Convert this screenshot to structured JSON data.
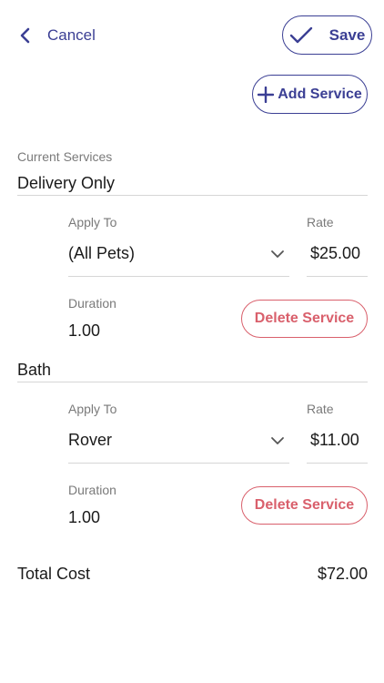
{
  "header": {
    "cancel_label": "Cancel",
    "save_label": "Save"
  },
  "actions": {
    "add_service_label": "Add Service"
  },
  "services_section": {
    "title": "Current Services"
  },
  "services": [
    {
      "name": "Delivery Only",
      "apply_to_label": "Apply To",
      "apply_to_value": "(All Pets)",
      "rate_label": "Rate",
      "rate_value": "$25.00",
      "duration_label": "Duration",
      "duration_value": "1.00",
      "delete_label": "Delete Service"
    },
    {
      "name": "Bath",
      "apply_to_label": "Apply To",
      "apply_to_value": "Rover",
      "rate_label": "Rate",
      "rate_value": "$11.00",
      "duration_label": "Duration",
      "duration_value": "1.00",
      "delete_label": "Delete Service"
    }
  ],
  "total": {
    "label": "Total Cost",
    "value": "$72.00"
  },
  "colors": {
    "accent": "#3b3f94",
    "danger": "#d9606c",
    "muted": "#7a7a7a",
    "divider": "#d6d6d6"
  },
  "icons": {
    "back": "chevron-left-icon",
    "save": "check-icon",
    "add": "plus-icon",
    "dropdown": "chevron-down-icon"
  }
}
